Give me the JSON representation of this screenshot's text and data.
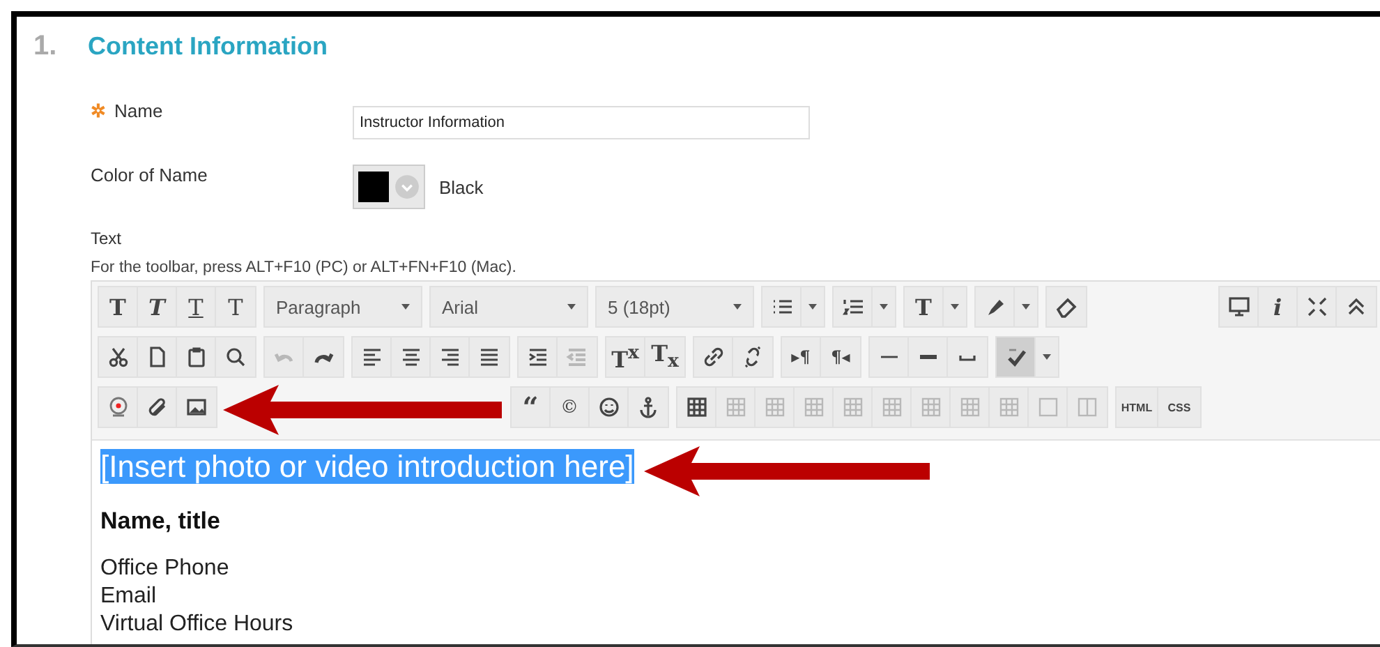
{
  "section": {
    "number": "1.",
    "title": "Content Information"
  },
  "fields": [
    {
      "kind": "text",
      "required_mark": "✲",
      "label": "Name",
      "value": "Instructor Information"
    },
    {
      "kind": "color",
      "label": "Color of Name",
      "color": "#000000",
      "value": "Black"
    }
  ],
  "text_label": "Text",
  "toolbar_hint": "For the toolbar, press ALT+F10 (PC) or ALT+FN+F10 (Mac).",
  "toolbar": {
    "rows": [
      {
        "groups": [
          {
            "kind": "buttons",
            "buttons": [
              {
                "kind": "bold",
                "label": "T",
                "disabled": false
              },
              {
                "kind": "italic",
                "label": "T",
                "disabled": false
              },
              {
                "kind": "underline",
                "label": "T",
                "disabled": false
              },
              {
                "kind": "strike",
                "label": "T",
                "disabled": false
              }
            ]
          },
          {
            "kind": "combo",
            "value": "Paragraph"
          },
          {
            "kind": "combo",
            "value": "Arial"
          },
          {
            "kind": "combo",
            "value": "5 (18pt)"
          },
          {
            "kind": "split",
            "buttons": [
              {
                "kind": "bullet-list",
                "disabled": false
              }
            ]
          },
          {
            "kind": "split",
            "buttons": [
              {
                "kind": "numbered-list",
                "disabled": false
              }
            ]
          },
          {
            "kind": "split",
            "buttons": [
              {
                "kind": "text-color",
                "label": "T",
                "disabled": false
              }
            ]
          },
          {
            "kind": "split",
            "buttons": [
              {
                "kind": "highlighter",
                "disabled": false
              }
            ]
          },
          {
            "kind": "buttons",
            "buttons": [
              {
                "kind": "eraser",
                "disabled": false
              }
            ]
          }
        ],
        "right_groups": [
          {
            "kind": "buttons",
            "buttons": [
              {
                "kind": "monitor",
                "disabled": false
              },
              {
                "kind": "info",
                "label": "i",
                "disabled": false
              },
              {
                "kind": "expand",
                "disabled": false
              },
              {
                "kind": "collapse",
                "disabled": false
              }
            ]
          }
        ]
      },
      {
        "groups": [
          {
            "kind": "buttons",
            "buttons": [
              {
                "kind": "cut",
                "disabled": false
              },
              {
                "kind": "copy",
                "disabled": false
              },
              {
                "kind": "paste",
                "disabled": false
              },
              {
                "kind": "find",
                "disabled": false
              }
            ]
          },
          {
            "kind": "buttons",
            "buttons": [
              {
                "kind": "undo",
                "disabled": true
              },
              {
                "kind": "redo",
                "disabled": false
              }
            ]
          },
          {
            "kind": "buttons",
            "buttons": [
              {
                "kind": "align-left",
                "disabled": false
              },
              {
                "kind": "align-center",
                "disabled": false
              },
              {
                "kind": "align-right",
                "disabled": false
              },
              {
                "kind": "justify",
                "disabled": false
              }
            ]
          },
          {
            "kind": "buttons",
            "buttons": [
              {
                "kind": "indent",
                "disabled": false
              },
              {
                "kind": "outdent",
                "disabled": true
              }
            ]
          },
          {
            "kind": "buttons",
            "buttons": [
              {
                "kind": "superscript",
                "label": "T$^{x}$",
                "disabled": false
              },
              {
                "kind": "subscript",
                "label": "T$_{x}$",
                "disabled": false
              }
            ]
          },
          {
            "kind": "buttons",
            "buttons": [
              {
                "kind": "link",
                "disabled": false
              },
              {
                "kind": "unlink",
                "disabled": false
              }
            ]
          },
          {
            "kind": "buttons",
            "buttons": [
              {
                "kind": "ltr",
                "label": "▸¶",
                "disabled": false
              },
              {
                "kind": "rtl",
                "label": "¶◂",
                "disabled": false
              }
            ]
          },
          {
            "kind": "buttons",
            "buttons": [
              {
                "kind": "hr-thin",
                "disabled": false
              },
              {
                "kind": "hr-thick",
                "disabled": false
              },
              {
                "kind": "nbsp",
                "disabled": false
              }
            ]
          },
          {
            "kind": "split",
            "pressed": true,
            "buttons": [
              {
                "kind": "spellcheck",
                "disabled": false
              }
            ]
          }
        ],
        "right_groups": []
      },
      {
        "groups": [
          {
            "kind": "buttons",
            "buttons": [
              {
                "kind": "record",
                "disabled": false
              },
              {
                "kind": "attach",
                "disabled": false
              },
              {
                "kind": "image",
                "disabled": false
              }
            ]
          },
          {
            "kind": "covered"
          },
          {
            "kind": "buttons",
            "buttons": [
              {
                "kind": "quote",
                "label": "“",
                "disabled": false
              },
              {
                "kind": "copyright",
                "label": "©",
                "disabled": false
              },
              {
                "kind": "smiley",
                "disabled": false
              },
              {
                "kind": "anchor",
                "disabled": false
              }
            ]
          },
          {
            "kind": "buttons",
            "buttons": [
              {
                "kind": "table",
                "disabled": false
              },
              {
                "kind": "table-op",
                "disabled": true
              },
              {
                "kind": "table-op",
                "disabled": true
              },
              {
                "kind": "table-op",
                "disabled": true
              },
              {
                "kind": "table-op",
                "disabled": true
              },
              {
                "kind": "table-op",
                "disabled": true
              },
              {
                "kind": "table-op",
                "disabled": true
              },
              {
                "kind": "table-op",
                "disabled": true
              },
              {
                "kind": "table-op",
                "disabled": true
              },
              {
                "kind": "cell",
                "disabled": true
              },
              {
                "kind": "columns",
                "disabled": true
              }
            ]
          },
          {
            "kind": "buttons",
            "buttons": [
              {
                "kind": "html",
                "label": "HTML",
                "disabled": false
              },
              {
                "kind": "css",
                "label": "CSS",
                "disabled": false
              }
            ]
          }
        ],
        "right_groups": []
      }
    ]
  },
  "content": [
    {
      "kind": "large",
      "selected": true,
      "lines": [
        "[Insert photo or video introduction here]"
      ]
    },
    {
      "kind": "bold",
      "selected": false,
      "lines": [
        "Name, title"
      ]
    },
    {
      "kind": "normal",
      "selected": false,
      "lines": [
        "Office Phone",
        "Email",
        "Virtual Office Hours"
      ]
    }
  ]
}
